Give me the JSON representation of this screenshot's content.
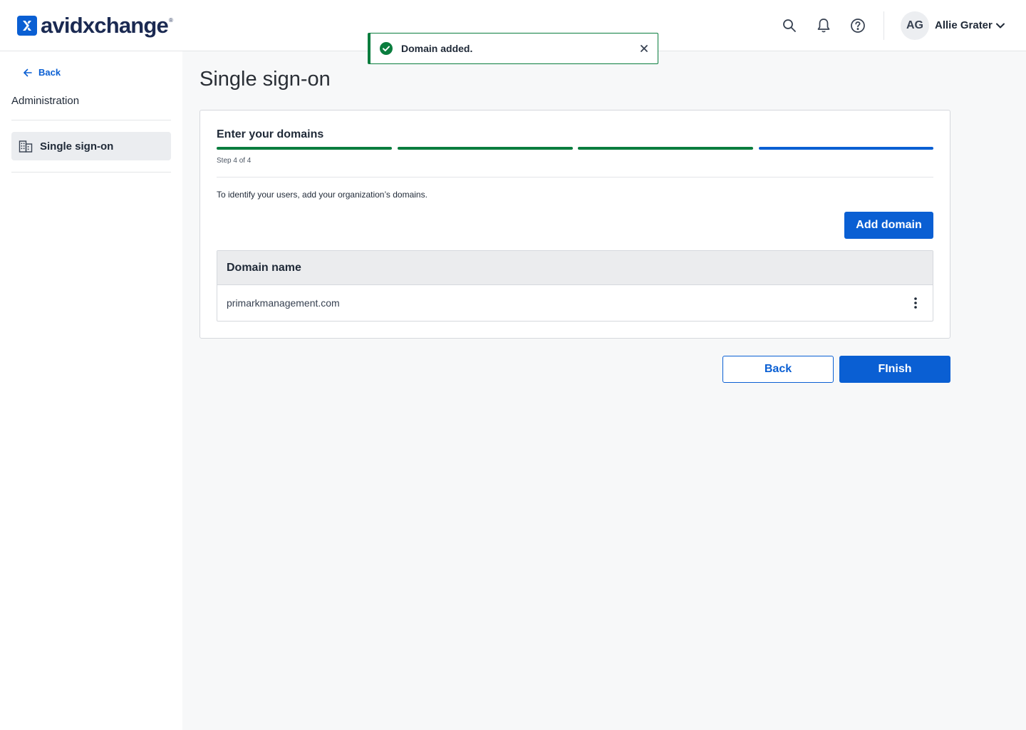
{
  "app": {
    "brand": "avidxchange",
    "brand_mark": "®",
    "colors": {
      "primary": "#0a5fd3",
      "success": "#0a7d3e",
      "brand_navy": "#1b2a52"
    }
  },
  "header": {
    "icons": [
      "search-icon",
      "bell-icon",
      "help-icon"
    ],
    "user": {
      "initials": "AG",
      "name": "Allie Grater"
    }
  },
  "toast": {
    "message": "Domain added.",
    "icon": "check-circle-icon",
    "close_icon": "close-icon"
  },
  "sidebar": {
    "back_label": "Back",
    "section_title": "Administration",
    "items": [
      {
        "label": "Single sign-on",
        "icon": "building-icon",
        "active": true
      }
    ]
  },
  "main": {
    "page_title": "Single sign-on",
    "wizard": {
      "step_title": "Enter your domains",
      "step_caption": "Step 4 of 4",
      "current_step": 4,
      "total_steps": 4,
      "step_states": [
        "complete",
        "complete",
        "complete",
        "current"
      ],
      "description": "To identify your users, add your organization’s domains.",
      "add_domain_label": "Add domain",
      "table": {
        "column_header": "Domain name",
        "rows": [
          {
            "domain": "primarkmanagement.com"
          }
        ]
      }
    },
    "back_label": "Back",
    "finish_label": "FInish"
  }
}
